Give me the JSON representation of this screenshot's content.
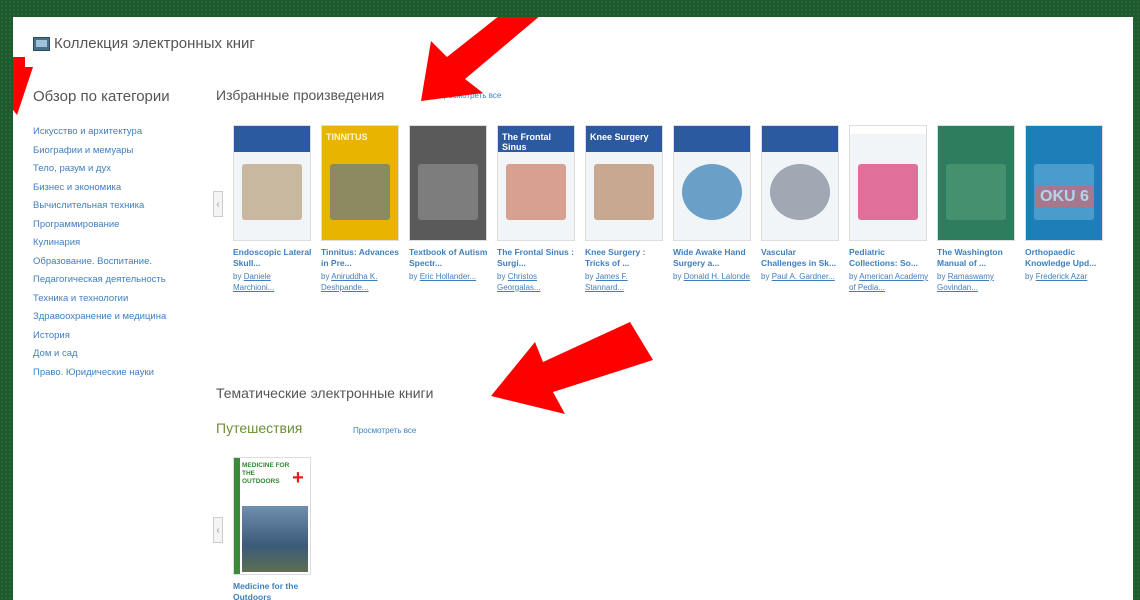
{
  "header": {
    "title": "Коллекция электронных книг"
  },
  "sidebar": {
    "heading": "Обзор по категории",
    "items": [
      "Искусство и архитектура",
      "Биографии и мемуары",
      "Тело, разум и дух",
      "Бизнес и экономика",
      "Вычислительная техника",
      "Программирование",
      "Кулинария",
      "Образование. Воспитание.",
      "Педагогическая деятельность",
      "Техника и технологии",
      "Здравоохранение и медицина",
      "История",
      "Дом и сад",
      "Право. Юридические науки"
    ]
  },
  "featured": {
    "title": "Избранные произведения",
    "view_all": "Просмотреть все",
    "books": [
      {
        "title": "Endoscopic Lateral Skull...",
        "author": "Daniele Marchioni...",
        "cover_color": "#2c5aa0"
      },
      {
        "title": "Tinnitus: Advances in Pre...",
        "author": "Aniruddha K. Deshpande...",
        "cover_color": "#e8b400",
        "cover_text": "TINNITUS"
      },
      {
        "title": "Textbook of Autism Spectr...",
        "author": "Eric Hollander...",
        "cover_color": "#5a5a5a"
      },
      {
        "title": "The Frontal Sinus : Surgi...",
        "author": "Christos Georgalas...",
        "cover_color": "#2c5aa0",
        "cover_text": "The Frontal Sinus"
      },
      {
        "title": "Knee Surgery : Tricks of ...",
        "author": "James F. Stannard...",
        "cover_color": "#2c5aa0",
        "cover_text": "Knee Surgery"
      },
      {
        "title": "Wide Awake Hand Surgery a...",
        "author": "Donald H. Lalonde",
        "cover_color": "#2c5aa0"
      },
      {
        "title": "Vascular Challenges in Sk...",
        "author": "Paul A. Gardner...",
        "cover_color": "#2c5aa0"
      },
      {
        "title": "Pediatric Collections: So...",
        "author": "American Academy of Pedia...",
        "cover_color": "#ffffff"
      },
      {
        "title": "The Washington Manual of ...",
        "author": "Ramaswamy Govindan...",
        "cover_color": "#2e7d5e"
      },
      {
        "title": "Orthopaedic Knowledge Upd...",
        "author": "Frederick Azar",
        "cover_color": "#1e7fb8",
        "cover_text": "OKU 6"
      }
    ]
  },
  "thematic": {
    "title": "Тематические электронные книги",
    "subsection": "Путешествия",
    "view_all": "Просмотреть все",
    "books": [
      {
        "title": "Medicine for the Outdoors",
        "cover_text": "MEDICINE FOR THE OUTDOORS"
      }
    ]
  },
  "by_label": "by",
  "colors": {
    "link": "#3f7fbf",
    "subsection": "#6b8e3a",
    "frame": "#1f5a2e",
    "arrow": "#ff0000"
  }
}
